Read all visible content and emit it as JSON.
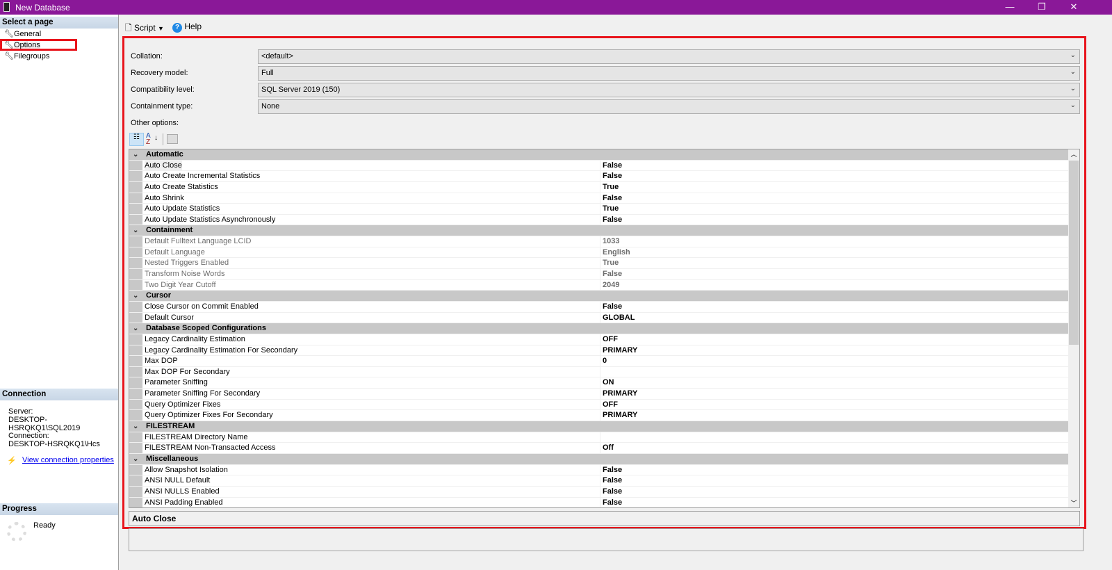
{
  "window": {
    "title": "New Database",
    "minimize": "—",
    "restore": "❐",
    "close": "✕"
  },
  "sidebar": {
    "select_header": "Select a page",
    "items": [
      {
        "label": "General"
      },
      {
        "label": "Options"
      },
      {
        "label": "Filegroups"
      }
    ],
    "connection_header": "Connection",
    "server_label": "Server:",
    "server_value": "DESKTOP-HSRQKQ1\\SQL2019",
    "connection_label": "Connection:",
    "connection_value": "DESKTOP-HSRQKQ1\\Hcs",
    "view_link": "View connection properties",
    "progress_header": "Progress",
    "progress_status": "Ready"
  },
  "toolbar": {
    "script": "Script",
    "help": "Help"
  },
  "form": {
    "collation_label": "Collation:",
    "collation_value": "<default>",
    "recovery_label": "Recovery model:",
    "recovery_value": "Full",
    "compat_label": "Compatibility level:",
    "compat_value": "SQL Server 2019 (150)",
    "containment_label": "Containment type:",
    "containment_value": "None",
    "other_label": "Other options:"
  },
  "grid": [
    {
      "cat": "Automatic",
      "rows": [
        [
          "Auto Close",
          "False"
        ],
        [
          "Auto Create Incremental Statistics",
          "False"
        ],
        [
          "Auto Create Statistics",
          "True"
        ],
        [
          "Auto Shrink",
          "False"
        ],
        [
          "Auto Update Statistics",
          "True"
        ],
        [
          "Auto Update Statistics Asynchronously",
          "False"
        ]
      ]
    },
    {
      "cat": "Containment",
      "disabled": true,
      "rows": [
        [
          "Default Fulltext Language LCID",
          "1033"
        ],
        [
          "Default Language",
          "English"
        ],
        [
          "Nested Triggers Enabled",
          "True"
        ],
        [
          "Transform Noise Words",
          "False"
        ],
        [
          "Two Digit Year Cutoff",
          "2049"
        ]
      ]
    },
    {
      "cat": "Cursor",
      "rows": [
        [
          "Close Cursor on Commit Enabled",
          "False"
        ],
        [
          "Default Cursor",
          "GLOBAL"
        ]
      ]
    },
    {
      "cat": "Database Scoped Configurations",
      "rows": [
        [
          "Legacy Cardinality Estimation",
          "OFF"
        ],
        [
          "Legacy Cardinality Estimation For Secondary",
          "PRIMARY"
        ],
        [
          "Max DOP",
          "0"
        ],
        [
          "Max DOP For Secondary",
          ""
        ],
        [
          "Parameter Sniffing",
          "ON"
        ],
        [
          "Parameter Sniffing For Secondary",
          "PRIMARY"
        ],
        [
          "Query Optimizer Fixes",
          "OFF"
        ],
        [
          "Query Optimizer Fixes For Secondary",
          "PRIMARY"
        ]
      ]
    },
    {
      "cat": "FILESTREAM",
      "rows": [
        [
          "FILESTREAM Directory Name",
          ""
        ],
        [
          "FILESTREAM Non-Transacted Access",
          "Off"
        ]
      ]
    },
    {
      "cat": "Miscellaneous",
      "rows": [
        [
          "Allow Snapshot Isolation",
          "False"
        ],
        [
          "ANSI NULL Default",
          "False"
        ],
        [
          "ANSI NULLS Enabled",
          "False"
        ],
        [
          "ANSI Padding Enabled",
          "False"
        ]
      ]
    }
  ],
  "description": {
    "title": "Auto Close"
  }
}
